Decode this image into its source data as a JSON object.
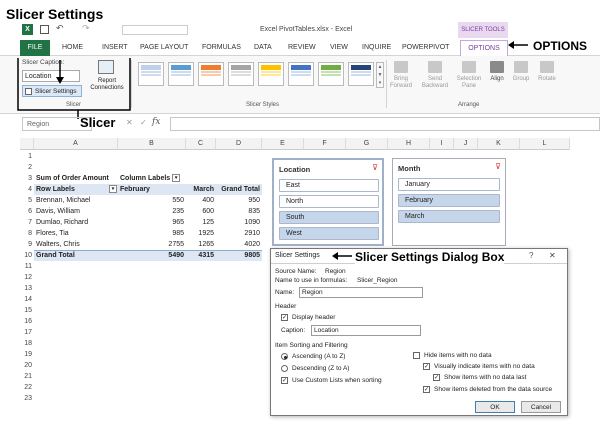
{
  "annotations": {
    "slicer_settings": "Slicer Settings",
    "options": "OPTIONS",
    "slicer": "Slicer",
    "dialog_box": "Slicer Settings Dialog Box"
  },
  "window": {
    "title": "Excel PivotTables.xlsx - Excel",
    "slicer_tools": "SLICER TOOLS",
    "help": "?"
  },
  "tabs": [
    "FILE",
    "HOME",
    "INSERT",
    "PAGE LAYOUT",
    "FORMULAS",
    "DATA",
    "REVIEW",
    "VIEW",
    "INQUIRE",
    "POWERPIVOT",
    "OPTIONS"
  ],
  "ribbon": {
    "slicer_caption_label": "Slicer Caption:",
    "slicer_caption_value": "Location",
    "slicer_settings_btn": "Slicer Settings",
    "report_connections": "Report Connections",
    "group_slicer": "Slicer",
    "group_styles": "Slicer Styles",
    "group_arrange": "Arrange",
    "bring_forward": "Bring Forward",
    "send_backward": "Send Backward",
    "selection_pane": "Selection Pane",
    "align": "Align",
    "group": "Group",
    "rotate": "Rotate"
  },
  "formula_bar": {
    "name_box": "Region",
    "fx": "fx",
    "cancel": "✕",
    "enter": "✓"
  },
  "columns": [
    "A",
    "B",
    "C",
    "D",
    "E",
    "F",
    "G",
    "H",
    "I",
    "J",
    "K",
    "L"
  ],
  "rows": [
    "1",
    "2",
    "3",
    "4",
    "5",
    "6",
    "7",
    "8",
    "9",
    "10",
    "11",
    "12",
    "13",
    "14",
    "15",
    "16",
    "17",
    "18",
    "19",
    "20",
    "21",
    "22",
    "23"
  ],
  "pivot": {
    "sum_label": "Sum of Order Amount",
    "column_labels": "Column Labels",
    "row_labels": "Row Labels",
    "headers": [
      "February",
      "March",
      "Grand Total"
    ],
    "data": [
      {
        "name": "Brennan, Michael",
        "feb": "550",
        "mar": "400",
        "total": "950"
      },
      {
        "name": "Davis, William",
        "feb": "235",
        "mar": "600",
        "total": "835"
      },
      {
        "name": "Dumlao, Richard",
        "feb": "965",
        "mar": "125",
        "total": "1090"
      },
      {
        "name": "Flores, Tia",
        "feb": "985",
        "mar": "1925",
        "total": "2910"
      },
      {
        "name": "Walters, Chris",
        "feb": "2755",
        "mar": "1265",
        "total": "4020"
      }
    ],
    "grand_total": {
      "name": "Grand Total",
      "feb": "5490",
      "mar": "4315",
      "total": "9805"
    }
  },
  "slicer_location": {
    "title": "Location",
    "items": [
      {
        "label": "East",
        "selected": false
      },
      {
        "label": "North",
        "selected": false
      },
      {
        "label": "South",
        "selected": true
      },
      {
        "label": "West",
        "selected": true
      }
    ]
  },
  "slicer_month": {
    "title": "Month",
    "items": [
      {
        "label": "January",
        "selected": false
      },
      {
        "label": "February",
        "selected": true
      },
      {
        "label": "March",
        "selected": true
      }
    ]
  },
  "dialog": {
    "title": "Slicer Settings",
    "close": "✕",
    "source_name_label": "Source Name:",
    "source_name_value": "Region",
    "formula_name_label": "Name to use in formulas:",
    "formula_name_value": "Slicer_Region",
    "name_label": "Name:",
    "name_value": "Region",
    "header_section": "Header",
    "display_header": "Display header",
    "caption_label": "Caption:",
    "caption_value": "Location",
    "sorting_section": "Item Sorting and Filtering",
    "ascending": "Ascending (A to Z)",
    "descending": "Descending (Z to A)",
    "custom_lists": "Use Custom Lists when sorting",
    "hide_no_data": "Hide items with no data",
    "indicate_no_data": "Visually indicate items with no data",
    "show_no_data_last": "Show items with no data last",
    "show_deleted": "Show items deleted from the data source",
    "ok": "OK",
    "cancel": "Cancel"
  },
  "colors": {
    "excel_green": "#217346",
    "slicer_tools": "#7a3fa0",
    "selected": "#c5d5ea"
  }
}
